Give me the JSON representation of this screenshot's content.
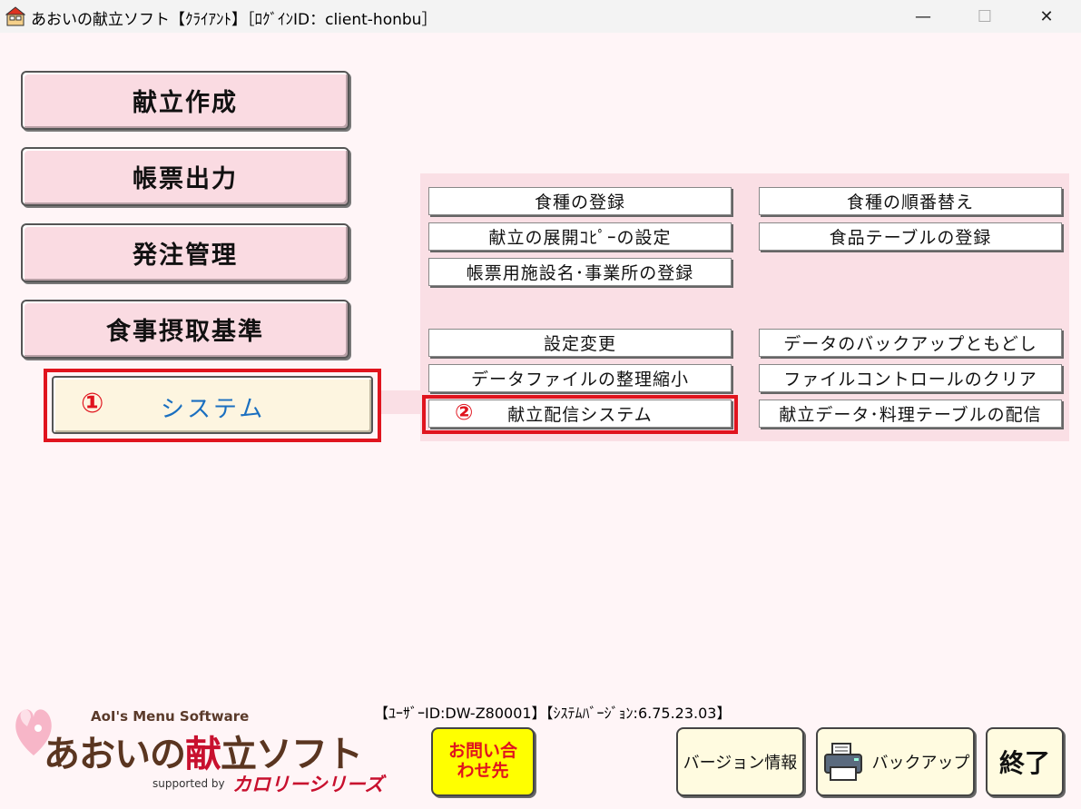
{
  "window": {
    "title": "あおいの献立ソフト【ｸﾗｲｱﾝﾄ】［ﾛｸﾞｲﾝID：client-honbu］",
    "minimize_glyph": "—",
    "maximize_glyph": "☐",
    "close_glyph": "✕"
  },
  "main_menu": {
    "menu_create": "献立作成",
    "report_output": "帳票出力",
    "order_management": "発注管理",
    "intake_standard": "食事摂取基準",
    "system": "システム",
    "system_marker": "①"
  },
  "system_panel": {
    "meal_type_register": "食種の登録",
    "meal_type_order": "食種の順番替え",
    "menu_copy_setting": "献立の展開ｺﾋﾟｰの設定",
    "food_table_register": "食品テーブルの登録",
    "facility_register": "帳票用施設名･事業所の登録",
    "settings_change": "設定変更",
    "data_backup": "データのバックアップともどし",
    "data_file_compact": "データファイルの整理縮小",
    "file_control_clear": "ファイルコントロールのクリア",
    "menu_distribution": "献立配信システム",
    "menu_distribution_marker": "②",
    "menu_data_distribution": "献立データ･料理テーブルの配信"
  },
  "footer": {
    "info": "【ﾕｰｻﾞｰID:DW-Z80001】【ｼｽﾃﾑﾊﾞｰｼﾞｮﾝ:6.75.23.03】",
    "logo_sub": "AoI's Menu Software",
    "logo_main_a": "あおいの",
    "logo_main_b": "献",
    "logo_main_c": "立ソフト",
    "logo_supported": "supported by",
    "logo_series": "カロリーシリーズ",
    "inquiry_line1": "お問い合",
    "inquiry_line2": "わせ先",
    "version_info": "バージョン情報",
    "backup": "バックアップ",
    "exit": "終了"
  },
  "colors": {
    "background": "#fff5f7",
    "main_button": "#fadbe2",
    "panel": "#fadfe5",
    "highlight_red": "#e0141e",
    "system_text": "#1a6fc0",
    "inquiry_yellow": "#ffff00"
  }
}
